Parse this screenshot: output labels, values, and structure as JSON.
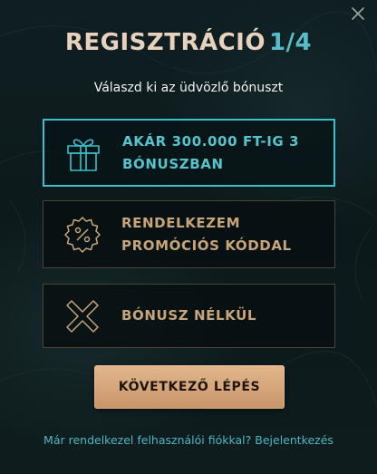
{
  "header": {
    "title": "REGISZTRÁCIÓ",
    "step": "1/4",
    "close_icon": "close-icon"
  },
  "subtitle": "Válaszd ki az üdvözlő bónuszt",
  "options": [
    {
      "line1": "AKÁR 300.000 FT-IG 3",
      "line2": "BÓNUSZBAN",
      "icon": "gift-icon",
      "selected": true
    },
    {
      "line1": "RENDELKEZEM",
      "line2": "PROMÓCIÓS KÓDDAL",
      "icon": "percent-badge-icon",
      "selected": false
    },
    {
      "line1": "BÓNUSZ NÉLKÜL",
      "line2": "",
      "icon": "no-bonus-x-icon",
      "selected": false
    }
  ],
  "next_button": "KÖVETKEZŐ LÉPÉS",
  "footer": {
    "question": "Már rendelkezel felhasználói fiókkal?",
    "login_link": "Bejelentkezés"
  },
  "colors": {
    "background": "#0d1b1d",
    "accent_teal": "#3cbfcb",
    "gold_text": "#c8a47a",
    "title_text": "#e8d2bd",
    "button": "#d9a97e"
  }
}
